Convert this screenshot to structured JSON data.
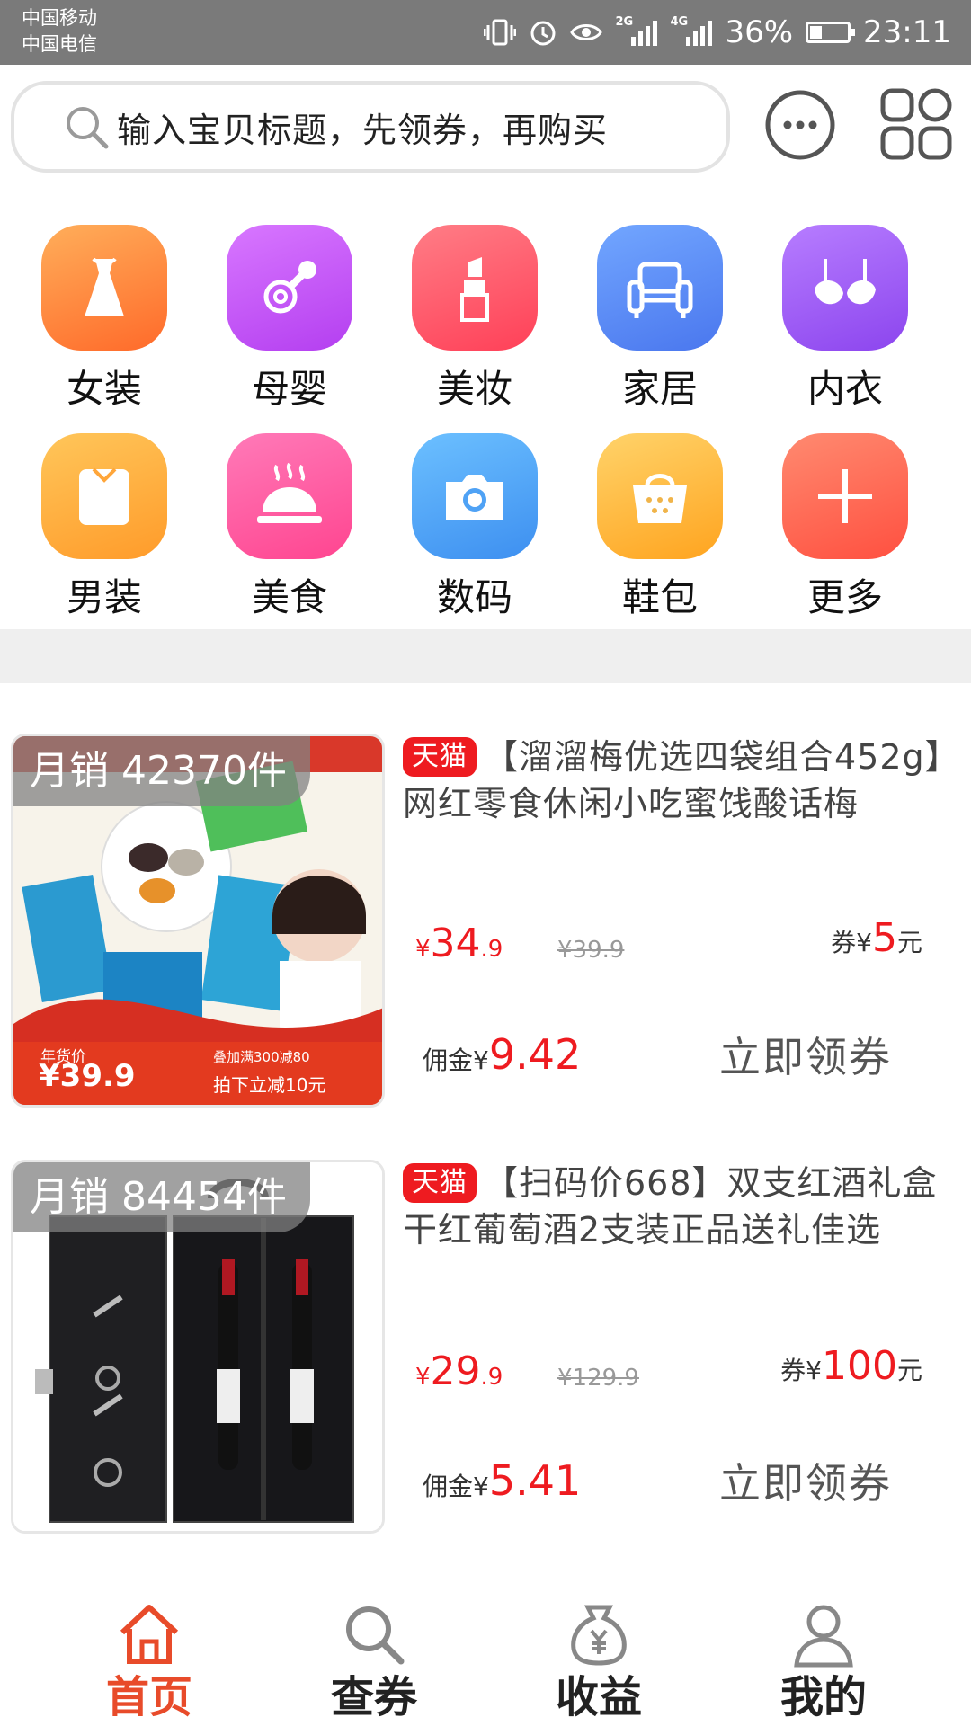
{
  "status_bar": {
    "carrier_1": "中国移动",
    "carrier_2": "中国电信",
    "net_2g": "2G",
    "net_4g": "4G",
    "battery": "36%",
    "time": "23:11"
  },
  "search": {
    "placeholder": "输入宝贝标题，先领券，再购买"
  },
  "categories": [
    {
      "label": "女装",
      "icon": "dress-icon",
      "color": "#ff8a3d"
    },
    {
      "label": "母婴",
      "icon": "pacifier-icon",
      "color": "#c65cf0"
    },
    {
      "label": "美妆",
      "icon": "lipstick-icon",
      "color": "#ff5a6e"
    },
    {
      "label": "家居",
      "icon": "sofa-icon",
      "color": "#5b8ef5"
    },
    {
      "label": "内衣",
      "icon": "bra-icon",
      "color": "#a25cf3"
    },
    {
      "label": "男装",
      "icon": "shirt-icon",
      "color": "#ffb13d"
    },
    {
      "label": "美食",
      "icon": "food-cloche-icon",
      "color": "#ff5fa0"
    },
    {
      "label": "数码",
      "icon": "camera-icon",
      "color": "#4fa8f5"
    },
    {
      "label": "鞋包",
      "icon": "handbag-icon",
      "color": "#ffba2e"
    },
    {
      "label": "更多",
      "icon": "plus-icon",
      "color": "#ff6a5c"
    }
  ],
  "products": [
    {
      "sales": "月销 42370件",
      "badge": "天猫",
      "title": "【溜溜梅优选四袋组合452g】网红零食休闲小吃蜜饯酸话梅",
      "price_yen": "¥",
      "price_int": "34",
      "price_dec": ".9",
      "original_price": "¥39.9",
      "coupon_prefix": "券¥",
      "coupon_amount": "5",
      "coupon_suffix": "元",
      "commission_prefix": "佣金¥",
      "commission_amount": "9.42",
      "claim_label": "立即领券",
      "thumb_text": {
        "year_label": "年货价",
        "year_price": "¥39.9",
        "promo_1": "叠加满300减80",
        "promo_2": "拍下立减10元"
      }
    },
    {
      "sales": "月销 84454件",
      "badge": "天猫",
      "title": "【扫码价668】双支红酒礼盒干红葡萄酒2支装正品送礼佳选",
      "price_yen": "¥",
      "price_int": "29",
      "price_dec": ".9",
      "original_price": "¥129.9",
      "coupon_prefix": "券¥",
      "coupon_amount": "100",
      "coupon_suffix": "元",
      "commission_prefix": "佣金¥",
      "commission_amount": "5.41",
      "claim_label": "立即领券"
    }
  ],
  "bottom_nav": [
    {
      "label": "首页",
      "icon": "home-icon",
      "active": true
    },
    {
      "label": "查券",
      "icon": "search-icon",
      "active": false
    },
    {
      "label": "收益",
      "icon": "money-bag-icon",
      "active": false
    },
    {
      "label": "我的",
      "icon": "user-icon",
      "active": false
    }
  ],
  "colors": {
    "accent": "#ee1b20",
    "nav_active": "#e84b2a",
    "status_bar": "#7a7a7a"
  }
}
